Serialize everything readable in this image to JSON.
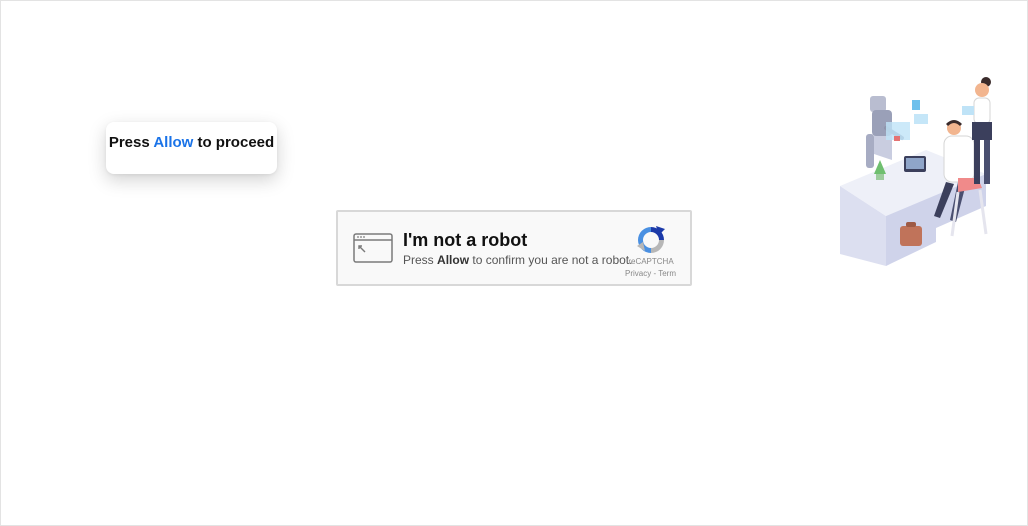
{
  "prompt": {
    "prefix": "Press",
    "highlight": "Allow",
    "suffix": "to proceed"
  },
  "captcha": {
    "title": "I'm not a robot",
    "sub_prefix": "Press",
    "sub_highlight": "Allow",
    "sub_suffix": "to confirm you are not a robot.",
    "brand": "reCAPTCHA",
    "privacy": "Privacy",
    "separator": "-",
    "terms": "Term"
  },
  "colors": {
    "accent": "#1a73e8",
    "recaptcha_blue": "#1c3aa9",
    "recaptcha_light": "#4a90e2",
    "recaptcha_gray": "#b7b7b7"
  },
  "icons": {
    "window": "browser-window-icon",
    "recaptcha": "recaptcha-logo-icon",
    "illustration": "office-robot-illustration"
  }
}
